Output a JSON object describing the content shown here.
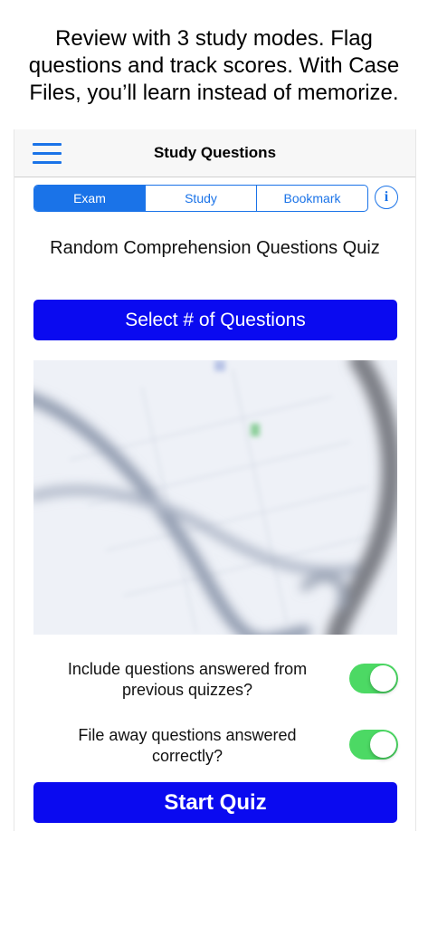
{
  "caption": {
    "line1": "Review with 3 study modes. Flag",
    "line2": "questions and track scores. With Case",
    "line3": "Files, you’ll learn instead of memorize."
  },
  "navbar": {
    "title": "Study Questions",
    "menu_icon": "hamburger-menu-icon"
  },
  "tabs": [
    {
      "label": "Exam",
      "selected": true
    },
    {
      "label": "Study",
      "selected": false
    },
    {
      "label": "Bookmark",
      "selected": false
    }
  ],
  "info_button": {
    "glyph": "i",
    "icon": "info-icon"
  },
  "quiz": {
    "title": "Random Comprehension Questions Quiz",
    "select_button": "Select # of Questions"
  },
  "options": [
    {
      "line1": "Include questions answered from",
      "line2": "previous quizzes?",
      "on": true
    },
    {
      "line1": "File away questions answered",
      "line2": "correctly?",
      "on": true
    }
  ],
  "start_button": "Start Quiz",
  "colors": {
    "accent": "#1a73e8",
    "button": "#0a0af0",
    "toggle_on": "#4cd964"
  }
}
